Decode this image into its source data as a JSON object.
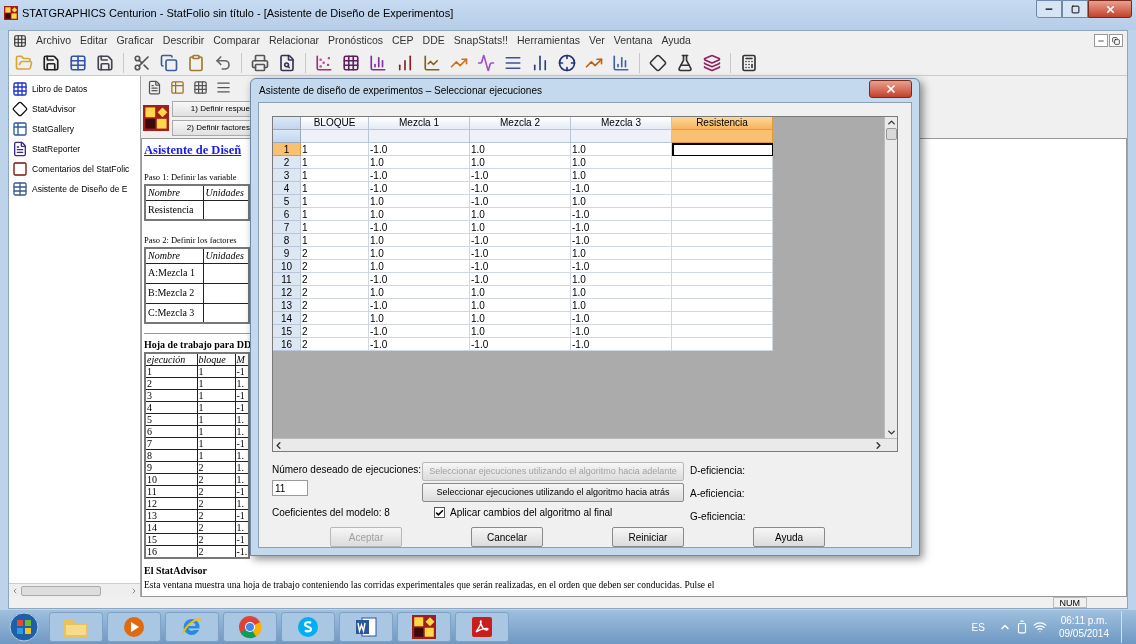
{
  "window": {
    "title": "STATGRAPHICS Centurion - StatFolio sin título - [Asistente de Diseño de Experimentos]"
  },
  "menu": [
    "Archivo",
    "Editar",
    "Graficar",
    "Describir",
    "Comparar",
    "Relacionar",
    "Pronósticos",
    "CEP",
    "DDE",
    "SnapStats!!",
    "Herramientas",
    "Ver",
    "Ventana",
    "Ayuda"
  ],
  "sidebar": {
    "items": [
      "Libro de Datos",
      "StatAdvisor",
      "StatGallery",
      "StatReporter",
      "Comentarios del StatFolic",
      "Asistente de Diseño de E"
    ]
  },
  "wizard": {
    "buttons": [
      "1) Definir respue",
      "2) Definir factores"
    ]
  },
  "document": {
    "title": "Asistente de Diseñ",
    "step1": {
      "caption": "Paso 1: Definir las variable",
      "columns": [
        "Nombre",
        "Unidades"
      ],
      "rows": [
        "Resistencia"
      ]
    },
    "step2": {
      "caption": "Paso 2: Definir los factores",
      "columns": [
        "Nombre",
        "Unidades"
      ],
      "rows": [
        "A:Mezcla 1",
        "B:Mezcla 2",
        "C:Mezcla 3"
      ]
    },
    "worksheet": {
      "caption": "Hoja de trabajo para DD",
      "columns": [
        "ejecución",
        "bloque",
        "M"
      ],
      "rows": [
        [
          "1",
          "1",
          "-1"
        ],
        [
          "2",
          "1",
          "1."
        ],
        [
          "3",
          "1",
          "-1"
        ],
        [
          "4",
          "1",
          "-1"
        ],
        [
          "5",
          "1",
          "1."
        ],
        [
          "6",
          "1",
          "1."
        ],
        [
          "7",
          "1",
          "-1"
        ],
        [
          "8",
          "1",
          "1."
        ],
        [
          "9",
          "2",
          "1."
        ],
        [
          "10",
          "2",
          "1."
        ],
        [
          "11",
          "2",
          "-1"
        ],
        [
          "12",
          "2",
          "1."
        ],
        [
          "13",
          "2",
          "-1"
        ],
        [
          "14",
          "2",
          "1."
        ],
        [
          "15",
          "2",
          "-1"
        ],
        [
          "16",
          "2",
          "-1."
        ]
      ]
    },
    "advisor_title": "El StatAdvisor",
    "advisor_text": "Esta ventana muestra una hoja de trabajo conteniendo las corridas experimentales que serán realizadas, en el orden que deben ser conducidas.  Pulse el"
  },
  "dialog": {
    "title": "Asistente de diseño de experimentos – Seleccionar ejecuciones",
    "columns": [
      {
        "label": "BLOQUE",
        "selected": false
      },
      {
        "label": "Mezcla 1",
        "selected": false
      },
      {
        "label": "Mezcla 2",
        "selected": false
      },
      {
        "label": "Mezcla 3",
        "selected": false
      },
      {
        "label": "Resistencia",
        "selected": true
      }
    ],
    "rows": [
      {
        "number": "1",
        "selected": true,
        "cells": [
          "1",
          "-1.0",
          "1.0",
          "1.0"
        ]
      },
      {
        "number": "2",
        "selected": false,
        "cells": [
          "1",
          "1.0",
          "1.0",
          "1.0"
        ]
      },
      {
        "number": "3",
        "selected": false,
        "cells": [
          "1",
          "-1.0",
          "-1.0",
          "1.0"
        ]
      },
      {
        "number": "4",
        "selected": false,
        "cells": [
          "1",
          "-1.0",
          "-1.0",
          "-1.0"
        ]
      },
      {
        "number": "5",
        "selected": false,
        "cells": [
          "1",
          "1.0",
          "-1.0",
          "1.0"
        ]
      },
      {
        "number": "6",
        "selected": false,
        "cells": [
          "1",
          "1.0",
          "1.0",
          "-1.0"
        ]
      },
      {
        "number": "7",
        "selected": false,
        "cells": [
          "1",
          "-1.0",
          "1.0",
          "-1.0"
        ]
      },
      {
        "number": "8",
        "selected": false,
        "cells": [
          "1",
          "1.0",
          "-1.0",
          "-1.0"
        ]
      },
      {
        "number": "9",
        "selected": false,
        "cells": [
          "2",
          "1.0",
          "-1.0",
          "1.0"
        ]
      },
      {
        "number": "10",
        "selected": false,
        "cells": [
          "2",
          "1.0",
          "-1.0",
          "-1.0"
        ]
      },
      {
        "number": "11",
        "selected": false,
        "cells": [
          "2",
          "-1.0",
          "-1.0",
          "1.0"
        ]
      },
      {
        "number": "12",
        "selected": false,
        "cells": [
          "2",
          "1.0",
          "1.0",
          "1.0"
        ]
      },
      {
        "number": "13",
        "selected": false,
        "cells": [
          "2",
          "-1.0",
          "1.0",
          "1.0"
        ]
      },
      {
        "number": "14",
        "selected": false,
        "cells": [
          "2",
          "1.0",
          "1.0",
          "-1.0"
        ]
      },
      {
        "number": "15",
        "selected": false,
        "cells": [
          "2",
          "-1.0",
          "1.0",
          "-1.0"
        ]
      },
      {
        "number": "16",
        "selected": false,
        "cells": [
          "2",
          "-1.0",
          "-1.0",
          "-1.0"
        ]
      }
    ],
    "runs_label": "Número deseado de ejecuciones:",
    "runs_value": "11",
    "coefficients": "Coeficientes del modelo: 8",
    "algorithm_buttons": [
      {
        "label": "Seleccionar ejecuciones utilizando el algoritmo hacia adelante",
        "disabled": true
      },
      {
        "label": "Seleccionar ejecuciones utilizando el algoritmo hacia atrás",
        "disabled": false
      }
    ],
    "apply_checkbox": {
      "label": "Aplicar cambios del algoritmo al final",
      "checked": true
    },
    "efficiency_labels": [
      "D-eficiencia:",
      "A-eficiencia:",
      "G-eficiencia:"
    ],
    "buttons": [
      {
        "label": "Aceptar",
        "disabled": true
      },
      {
        "label": "Cancelar",
        "disabled": false
      },
      {
        "label": "Reiniciar",
        "disabled": false
      },
      {
        "label": "Ayuda",
        "disabled": false
      }
    ]
  },
  "status_bar": {
    "indicator": "NUM"
  },
  "taskbar": {
    "language": "ES",
    "time": "06:11 p.m.",
    "date": "09/05/2014"
  }
}
